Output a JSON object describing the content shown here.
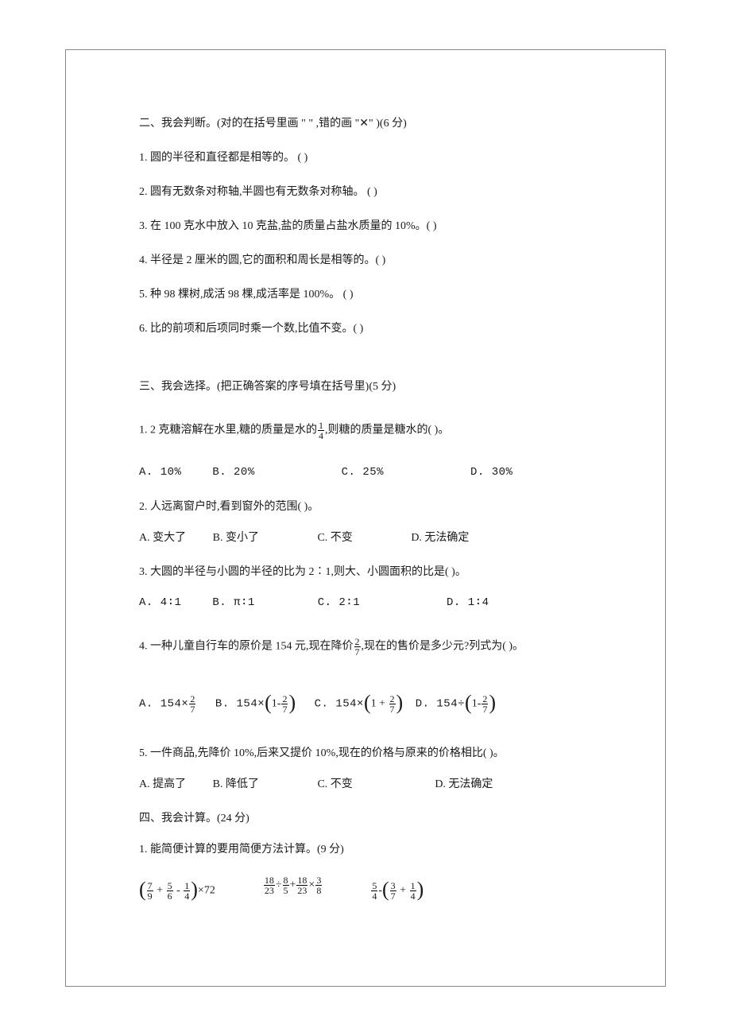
{
  "section2": {
    "heading": "二、我会判断。(对的在括号里画 \" \" ,错的画 \"✕\" )(6 分)",
    "items": [
      "1. 圆的半径和直径都是相等的。  (    )",
      "2. 圆有无数条对称轴,半圆也有无数条对称轴。  (    )",
      "3. 在 100 克水中放入 10 克盐,盐的质量占盐水质量的 10%。(    )",
      "4. 半径是 2 厘米的圆,它的面积和周长是相等的。(    )",
      "5. 种 98 棵树,成活 98 棵,成活率是 100%。  (    )",
      "6. 比的前项和后项同时乘一个数,比值不变。(    )"
    ]
  },
  "section3": {
    "heading": "三、我会选择。(把正确答案的序号填在括号里)(5 分)",
    "q1": {
      "stem_a": "1. 2 克糖溶解在水里,糖的质量是水的",
      "frac_num": "1",
      "frac_den": "4",
      "stem_b": ",则糖的质量是糖水的(    )。",
      "opts": {
        "a": "A. 10%",
        "b": "B. 20%",
        "c": "C. 25%",
        "d": "D. 30%"
      }
    },
    "q2": {
      "stem": "2. 人远离窗户时,看到窗外的范围(    )。",
      "opts": {
        "a": "A. 变大了",
        "b": "B. 变小了",
        "c": "C. 不变",
        "d": "D. 无法确定"
      }
    },
    "q3": {
      "stem": "3. 大圆的半径与小圆的半径的比为 2∶1,则大、小圆面积的比是(    )。",
      "opts": {
        "a": "A. 4∶1",
        "b": "B. π∶1",
        "c": "C. 2∶1",
        "d": "D. 1∶4"
      }
    },
    "q4": {
      "stem_a": "4. 一种儿童自行车的原价是 154 元,现在降价",
      "frac_num": "2",
      "frac_den": "7",
      "stem_b": ",现在的售价是多少元?列式为(    )。",
      "opts": {
        "a_pre": "A. 154×",
        "a_num": "2",
        "a_den": "7",
        "b_pre": "B. 154×",
        "b_num": "2",
        "b_den": "7",
        "c_pre": "C. 154×",
        "c_num": "2",
        "c_den": "7",
        "d_pre": "D. 154÷",
        "d_num": "2",
        "d_den": "7"
      }
    },
    "q5": {
      "stem": "5. 一件商品,先降价 10%,后来又提价 10%,现在的价格与原来的价格相比(    )。",
      "opts": {
        "a": "A. 提高了",
        "b": "B. 降低了",
        "c": "C. 不变",
        "d": "D. 无法确定"
      }
    }
  },
  "section4": {
    "heading": "四、我会计算。(24 分)",
    "sub1": "1. 能简便计算的要用简便方法计算。(9 分)",
    "expr1": {
      "f1n": "7",
      "f1d": "9",
      "f2n": "5",
      "f2d": "6",
      "f3n": "1",
      "f3d": "4",
      "tail": "×72"
    },
    "expr2": {
      "f1n": "18",
      "f1d": "23",
      "f2n": "8",
      "f2d": "5",
      "f3n": "18",
      "f3d": "23",
      "f4n": "3",
      "f4d": "8"
    },
    "expr3": {
      "f1n": "5",
      "f1d": "4",
      "f2n": "3",
      "f2d": "7",
      "f3n": "1",
      "f3d": "4"
    }
  }
}
